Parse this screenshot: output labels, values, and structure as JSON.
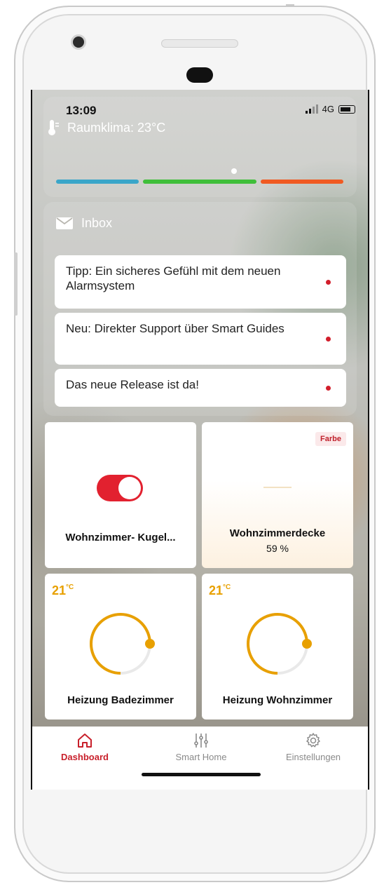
{
  "status_bar": {
    "time": "13:09",
    "network": "4G"
  },
  "climate": {
    "label": "Raumklima: 23°C",
    "icon": "thermometer-icon",
    "level": 0.62,
    "segments": [
      {
        "color": "#3aa6c9"
      },
      {
        "color": "#3fbf3a"
      },
      {
        "color": "#f05a22"
      }
    ]
  },
  "inbox": {
    "title": "Inbox",
    "icon": "mail-icon",
    "messages": [
      {
        "text": "Tipp: Ein sicheres Gefühl mit dem neuen Alarmsystem",
        "unread": true
      },
      {
        "text": "Neu: Direkter Support über Smart Guides",
        "unread": true
      },
      {
        "text": "Das neue Release ist da!",
        "unread": true
      }
    ]
  },
  "tiles": [
    {
      "name": "Wohnzimmer- Kugel...",
      "type": "switch",
      "on": true
    },
    {
      "name": "Wohnzimmerdecke",
      "type": "dimmer",
      "value": "59 %",
      "badge": "Farbe"
    },
    {
      "name": "Heizung Badezimmer",
      "type": "thermostat",
      "temp": "21",
      "unit": "°C",
      "level": 0.75
    },
    {
      "name": "Heizung Wohnzimmer",
      "type": "thermostat",
      "temp": "21",
      "unit": "°C",
      "level": 0.75
    }
  ],
  "nav": [
    {
      "label": "Dashboard",
      "icon": "home-icon",
      "active": true
    },
    {
      "label": "Smart Home",
      "icon": "sliders-icon",
      "active": false
    },
    {
      "label": "Einstellungen",
      "icon": "gear-icon",
      "active": false
    }
  ],
  "colors": {
    "accent": "#c8202b",
    "heat": "#e8a000"
  }
}
